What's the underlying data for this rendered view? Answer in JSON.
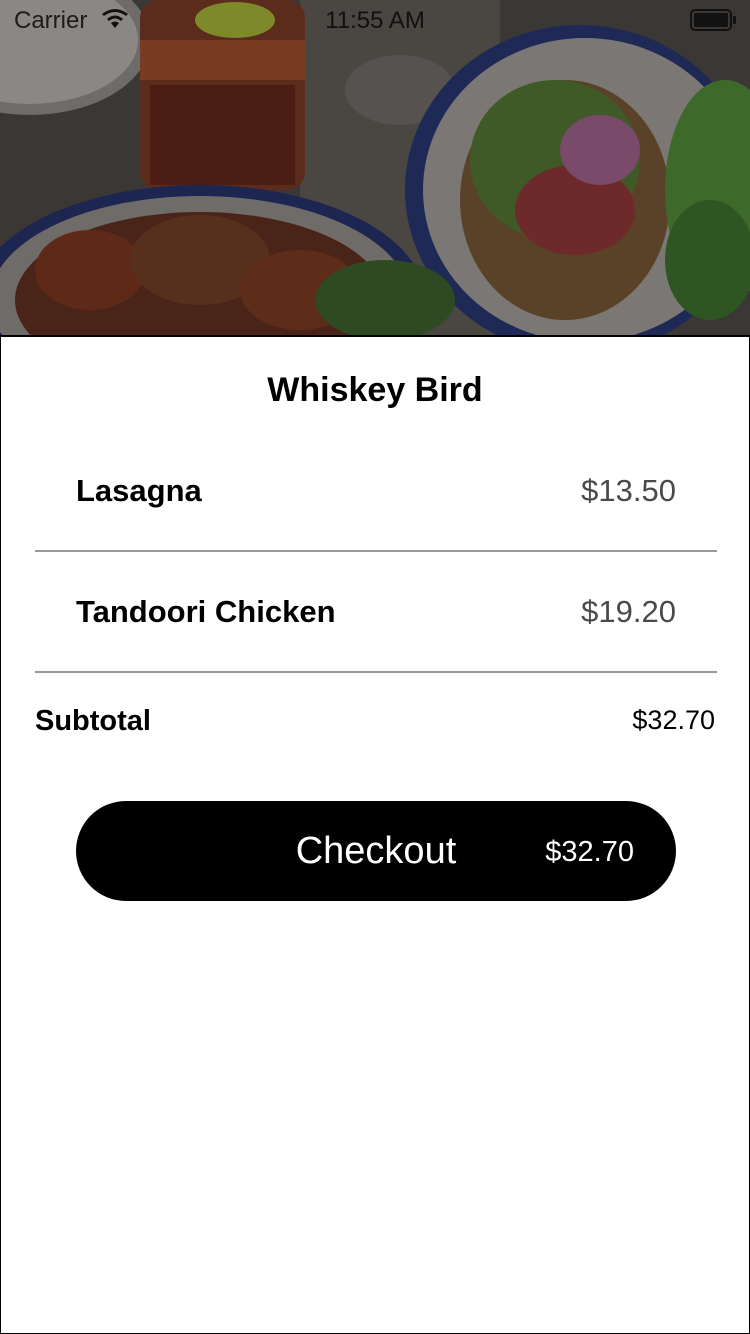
{
  "status_bar": {
    "carrier": "Carrier",
    "time": "11:55 AM"
  },
  "hero": {
    "icon": "food-photo"
  },
  "restaurant": {
    "name": "Whiskey Bird"
  },
  "cart": {
    "items": [
      {
        "name": "Lasagna",
        "price": "$13.50"
      },
      {
        "name": "Tandoori Chicken",
        "price": "$19.20"
      }
    ],
    "subtotal_label": "Subtotal",
    "subtotal_value": "$32.70"
  },
  "checkout": {
    "label": "Checkout",
    "price": "$32.70"
  },
  "colors": {
    "button_bg": "#000000",
    "button_text": "#ffffff",
    "divider": "#9a9a9a"
  }
}
